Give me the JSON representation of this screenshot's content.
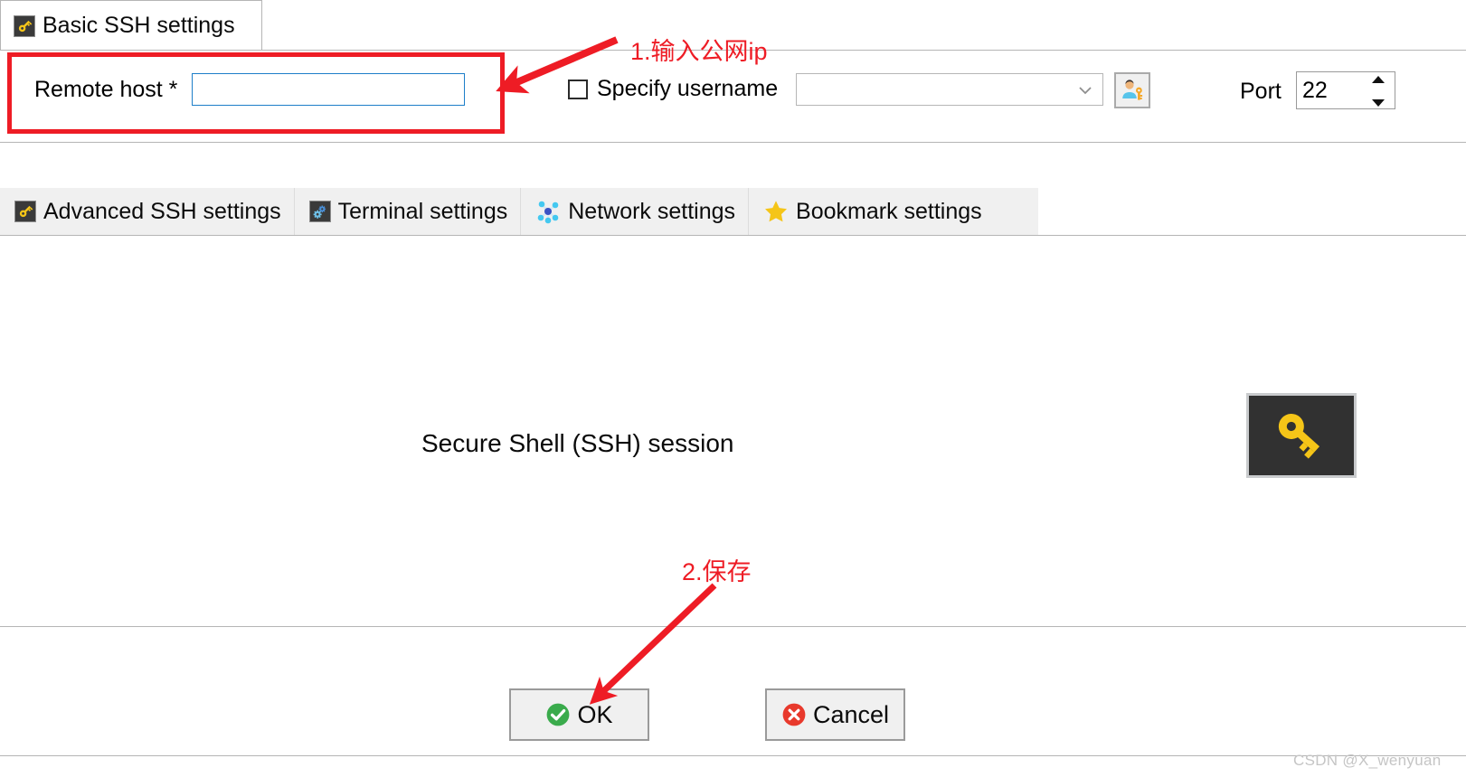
{
  "group": {
    "title": "Basic SSH settings",
    "icon": "key-icon"
  },
  "form": {
    "remote_host_label": "Remote host *",
    "remote_host_value": "",
    "remote_host_placeholder": "",
    "specify_username_label": "Specify username",
    "specify_username_checked": false,
    "username_value": "",
    "username_placeholder": "",
    "username_combo_icon": "chevron-down-icon",
    "user_key_button_icon": "user-key-icon",
    "port_label": "Port",
    "port_value": "22"
  },
  "tabs": [
    {
      "label": "Advanced SSH settings",
      "icon": "key-icon"
    },
    {
      "label": "Terminal settings",
      "icon": "gears-icon"
    },
    {
      "label": "Network settings",
      "icon": "network-nodes-icon"
    },
    {
      "label": "Bookmark settings",
      "icon": "star-icon"
    }
  ],
  "main": {
    "session_title": "Secure Shell (SSH) session",
    "session_icon": "key-icon"
  },
  "footer": {
    "ok_label": "OK",
    "ok_icon": "check-circle-icon",
    "cancel_label": "Cancel",
    "cancel_icon": "x-circle-icon"
  },
  "annotations": {
    "step1": "1.输入公网ip",
    "step2": "2.保存",
    "color": "#ee1c25"
  },
  "watermark": "CSDN @X_wenyuan",
  "colors": {
    "accent_red": "#ee1c25",
    "field_focus_blue": "#1d7ec9",
    "key_yellow": "#f5c518",
    "ok_green": "#3aab4c",
    "cancel_red": "#e8392c",
    "panel_gray": "#f0f0f0",
    "border_gray": "#b5b5b5"
  }
}
